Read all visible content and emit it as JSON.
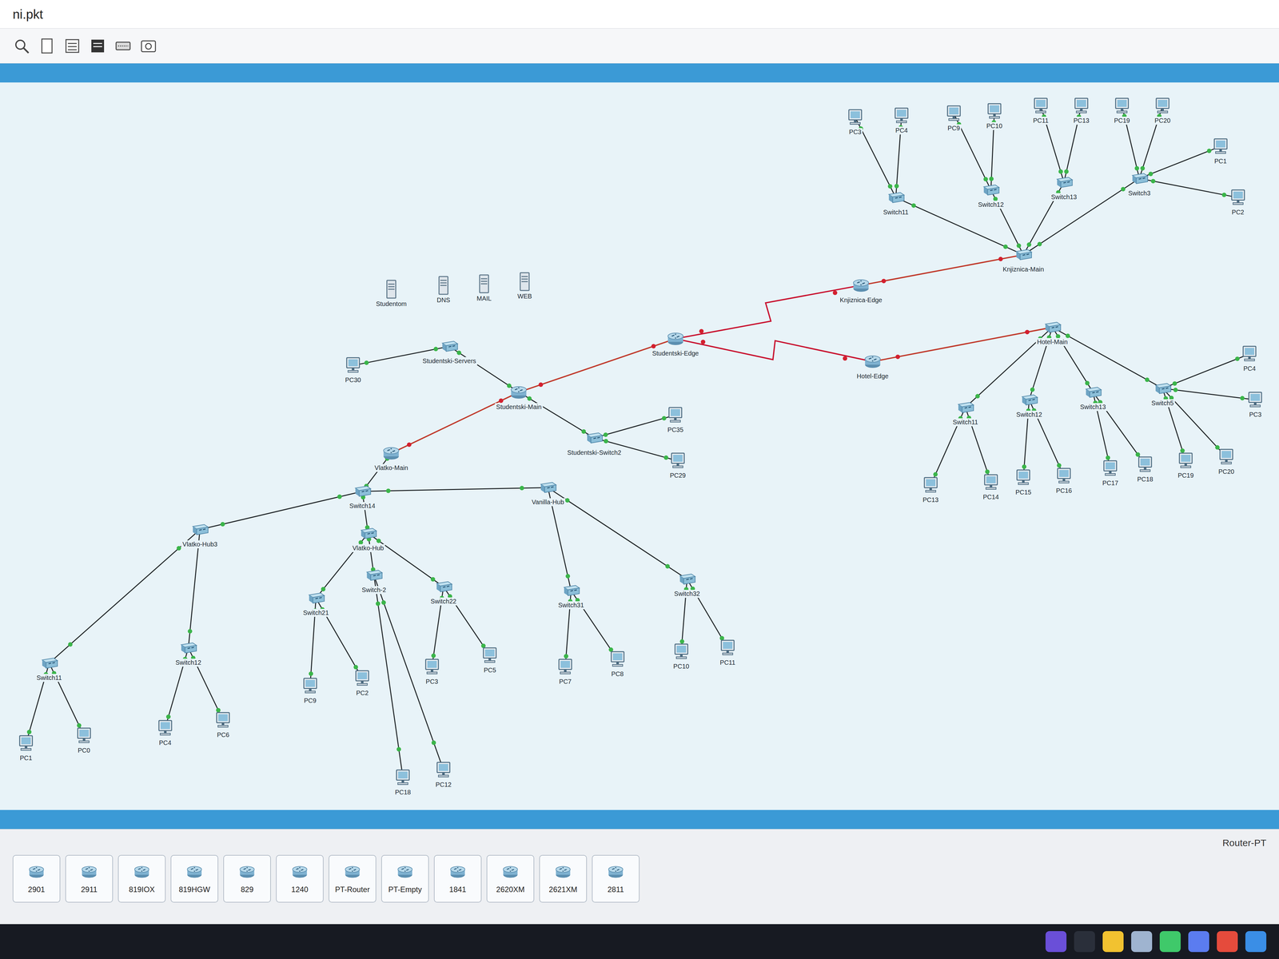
{
  "window": {
    "title": "ni.pkt"
  },
  "diagram": {
    "nodes": [
      {
        "label": "Studentski-Edge",
        "kind": "router"
      },
      {
        "label": "Knjiznica-Edge",
        "kind": "router"
      },
      {
        "label": "Hotel-Edge",
        "kind": "router"
      },
      {
        "label": "Studentski-Main",
        "kind": "router"
      },
      {
        "label": "Studentski-Servers",
        "kind": "switch"
      },
      {
        "label": "PC30",
        "kind": "pc"
      },
      {
        "label": "Studentski-Switch2",
        "kind": "switch"
      },
      {
        "label": "PC35",
        "kind": "pc"
      },
      {
        "label": "PC29",
        "kind": "pc"
      },
      {
        "label": "WEB",
        "kind": "server"
      },
      {
        "label": "MAIL",
        "kind": "server"
      },
      {
        "label": "DNS",
        "kind": "server"
      },
      {
        "label": "Studentom",
        "kind": "server"
      },
      {
        "label": "Vlatko-Main",
        "kind": "router"
      },
      {
        "label": "Switch14",
        "kind": "switch"
      },
      {
        "label": "Vanilla-Hub",
        "kind": "switch"
      },
      {
        "label": "Vlatko-Hub",
        "kind": "switch"
      },
      {
        "label": "Vlatko-Hub3",
        "kind": "switch"
      },
      {
        "label": "Switch32",
        "kind": "switch"
      },
      {
        "label": "PC11",
        "kind": "pc"
      },
      {
        "label": "PC10",
        "kind": "pc"
      },
      {
        "label": "Switch31",
        "kind": "switch"
      },
      {
        "label": "PC8",
        "kind": "pc"
      },
      {
        "label": "PC7",
        "kind": "pc"
      },
      {
        "label": "Switch22",
        "kind": "switch"
      },
      {
        "label": "PC5",
        "kind": "pc"
      },
      {
        "label": "PC3",
        "kind": "pc"
      },
      {
        "label": "Switch-2",
        "kind": "switch"
      },
      {
        "label": "PC12",
        "kind": "pc"
      },
      {
        "label": "PC18",
        "kind": "pc"
      },
      {
        "label": "Switch21",
        "kind": "switch"
      },
      {
        "label": "PC2",
        "kind": "pc"
      },
      {
        "label": "PC9",
        "kind": "pc"
      },
      {
        "label": "Switch12",
        "kind": "switch"
      },
      {
        "label": "PC6",
        "kind": "pc"
      },
      {
        "label": "PC4",
        "kind": "pc"
      },
      {
        "label": "Switch11",
        "kind": "switch"
      },
      {
        "label": "PC0",
        "kind": "pc"
      },
      {
        "label": "PC1",
        "kind": "pc"
      },
      {
        "label": "Knjiznica-Main",
        "kind": "switch"
      },
      {
        "label": "Switch3",
        "kind": "switch"
      },
      {
        "label": "PC20",
        "kind": "pc"
      },
      {
        "label": "PC19",
        "kind": "pc"
      },
      {
        "label": "PC1",
        "kind": "pc"
      },
      {
        "label": "PC2",
        "kind": "pc"
      },
      {
        "label": "Switch13",
        "kind": "switch"
      },
      {
        "label": "PC13",
        "kind": "pc"
      },
      {
        "label": "PC11",
        "kind": "pc"
      },
      {
        "label": "Switch12",
        "kind": "switch"
      },
      {
        "label": "PC10",
        "kind": "pc"
      },
      {
        "label": "PC9",
        "kind": "pc"
      },
      {
        "label": "Switch11",
        "kind": "switch"
      },
      {
        "label": "PC4",
        "kind": "pc"
      },
      {
        "label": "PC3",
        "kind": "pc"
      },
      {
        "label": "Hotel-Main",
        "kind": "switch"
      },
      {
        "label": "Switch5",
        "kind": "switch"
      },
      {
        "label": "PC4",
        "kind": "pc"
      },
      {
        "label": "PC3",
        "kind": "pc"
      },
      {
        "label": "PC20",
        "kind": "pc"
      },
      {
        "label": "PC19",
        "kind": "pc"
      },
      {
        "label": "Switch13",
        "kind": "switch"
      },
      {
        "label": "PC18",
        "kind": "pc"
      },
      {
        "label": "PC17",
        "kind": "pc"
      },
      {
        "label": "Switch12",
        "kind": "switch"
      },
      {
        "label": "PC16",
        "kind": "pc"
      },
      {
        "label": "PC15",
        "kind": "pc"
      },
      {
        "label": "Switch11",
        "kind": "switch"
      },
      {
        "label": "PC14",
        "kind": "pc"
      },
      {
        "label": "PC13",
        "kind": "pc"
      }
    ],
    "links": [
      {
        "from": 1,
        "to": 0,
        "kind": "serial"
      },
      {
        "from": 2,
        "to": 0,
        "kind": "serial"
      },
      {
        "from": 0,
        "to": 3,
        "kind": "fiber"
      },
      {
        "from": 3,
        "to": 13,
        "kind": "fiber"
      },
      {
        "from": 1,
        "to": 39,
        "kind": "fiber"
      },
      {
        "from": 2,
        "to": 54,
        "kind": "fiber"
      },
      {
        "from": 3,
        "to": 4,
        "kind": "copper"
      },
      {
        "from": 4,
        "to": 5,
        "kind": "copper"
      },
      {
        "from": 3,
        "to": 6,
        "kind": "copper"
      },
      {
        "from": 6,
        "to": 7,
        "kind": "copper"
      },
      {
        "from": 6,
        "to": 8,
        "kind": "copper"
      },
      {
        "from": 13,
        "to": 14,
        "kind": "copper"
      },
      {
        "from": 14,
        "to": 15,
        "kind": "copper"
      },
      {
        "from": 14,
        "to": 16,
        "kind": "copper"
      },
      {
        "from": 14,
        "to": 17,
        "kind": "copper"
      },
      {
        "from": 15,
        "to": 18,
        "kind": "copper"
      },
      {
        "from": 18,
        "to": 19,
        "kind": "copper"
      },
      {
        "from": 18,
        "to": 20,
        "kind": "copper"
      },
      {
        "from": 15,
        "to": 21,
        "kind": "copper"
      },
      {
        "from": 21,
        "to": 22,
        "kind": "copper"
      },
      {
        "from": 21,
        "to": 23,
        "kind": "copper"
      },
      {
        "from": 16,
        "to": 24,
        "kind": "copper"
      },
      {
        "from": 24,
        "to": 25,
        "kind": "copper"
      },
      {
        "from": 24,
        "to": 26,
        "kind": "copper"
      },
      {
        "from": 16,
        "to": 27,
        "kind": "copper"
      },
      {
        "from": 27,
        "to": 28,
        "kind": "copper"
      },
      {
        "from": 27,
        "to": 29,
        "kind": "copper"
      },
      {
        "from": 16,
        "to": 30,
        "kind": "copper"
      },
      {
        "from": 30,
        "to": 31,
        "kind": "copper"
      },
      {
        "from": 30,
        "to": 32,
        "kind": "copper"
      },
      {
        "from": 17,
        "to": 33,
        "kind": "copper"
      },
      {
        "from": 33,
        "to": 34,
        "kind": "copper"
      },
      {
        "from": 33,
        "to": 35,
        "kind": "copper"
      },
      {
        "from": 17,
        "to": 36,
        "kind": "copper"
      },
      {
        "from": 36,
        "to": 37,
        "kind": "copper"
      },
      {
        "from": 36,
        "to": 38,
        "kind": "copper"
      },
      {
        "from": 39,
        "to": 40,
        "kind": "copper"
      },
      {
        "from": 40,
        "to": 41,
        "kind": "copper"
      },
      {
        "from": 40,
        "to": 42,
        "kind": "copper"
      },
      {
        "from": 40,
        "to": 43,
        "kind": "copper"
      },
      {
        "from": 40,
        "to": 44,
        "kind": "copper"
      },
      {
        "from": 39,
        "to": 45,
        "kind": "copper"
      },
      {
        "from": 45,
        "to": 46,
        "kind": "copper"
      },
      {
        "from": 45,
        "to": 47,
        "kind": "copper"
      },
      {
        "from": 39,
        "to": 48,
        "kind": "copper"
      },
      {
        "from": 48,
        "to": 49,
        "kind": "copper"
      },
      {
        "from": 48,
        "to": 50,
        "kind": "copper"
      },
      {
        "from": 39,
        "to": 51,
        "kind": "copper"
      },
      {
        "from": 51,
        "to": 52,
        "kind": "copper"
      },
      {
        "from": 51,
        "to": 53,
        "kind": "copper"
      },
      {
        "from": 54,
        "to": 55,
        "kind": "copper"
      },
      {
        "from": 55,
        "to": 56,
        "kind": "copper"
      },
      {
        "from": 55,
        "to": 57,
        "kind": "copper"
      },
      {
        "from": 55,
        "to": 58,
        "kind": "copper"
      },
      {
        "from": 55,
        "to": 59,
        "kind": "copper"
      },
      {
        "from": 54,
        "to": 60,
        "kind": "copper"
      },
      {
        "from": 60,
        "to": 61,
        "kind": "copper"
      },
      {
        "from": 60,
        "to": 62,
        "kind": "copper"
      },
      {
        "from": 54,
        "to": 63,
        "kind": "copper"
      },
      {
        "from": 63,
        "to": 64,
        "kind": "copper"
      },
      {
        "from": 63,
        "to": 65,
        "kind": "copper"
      },
      {
        "from": 54,
        "to": 66,
        "kind": "copper"
      },
      {
        "from": 66,
        "to": 67,
        "kind": "copper"
      },
      {
        "from": 66,
        "to": 68,
        "kind": "copper"
      }
    ]
  },
  "palette": {
    "model": "Router-PT",
    "items": [
      "2901",
      "2911",
      "819IOX",
      "819HGW",
      "829",
      "1240",
      "PT-Router",
      "PT-Empty",
      "1841",
      "2620XM",
      "2621XM",
      "2811"
    ]
  }
}
